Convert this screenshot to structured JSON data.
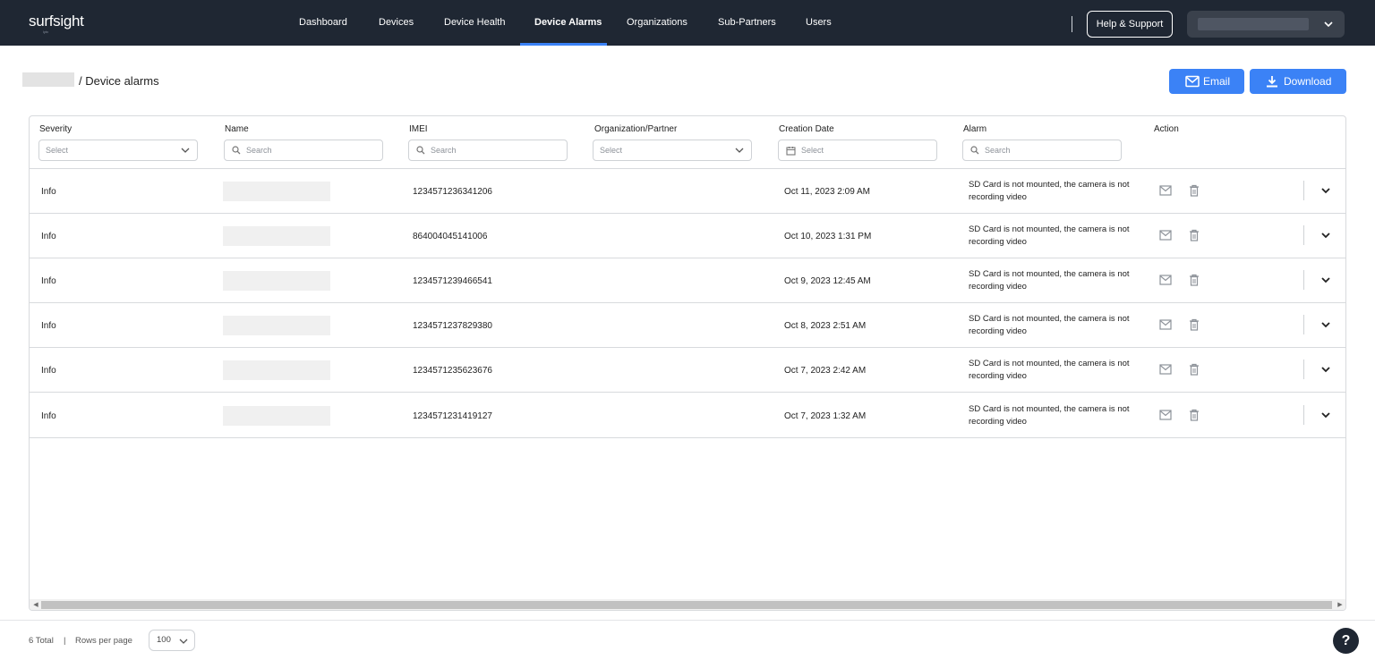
{
  "app": {
    "logo": "surfsight",
    "logo_sub": "lytx"
  },
  "nav": {
    "items": [
      "Dashboard",
      "Devices",
      "Device Health",
      "Device Alarms",
      "Organizations",
      "Sub-Partners",
      "Users"
    ],
    "active": "Device Alarms",
    "help_label": "Help & Support"
  },
  "page": {
    "title": "/ Device alarms"
  },
  "toolbar": {
    "email_label": "Email",
    "download_label": "Download"
  },
  "colors": {
    "nav_bg": "#1f2733",
    "accent": "#3b82f6"
  },
  "table": {
    "columns": [
      "Severity",
      "Name",
      "IMEI",
      "Organization/Partner",
      "Creation Date",
      "Alarm",
      "Action"
    ],
    "filters": {
      "severity": "Select",
      "name": "Search",
      "imei": "Search",
      "organization": "Select",
      "creation_date": "Select",
      "alarm": "Search"
    },
    "rows": [
      {
        "severity": "Info",
        "imei": "1234571236341206",
        "date": "Oct 11, 2023 2:09 AM",
        "alarm": "SD Card is not mounted, the camera is not recording video"
      },
      {
        "severity": "Info",
        "imei": "864004045141006",
        "date": "Oct 10, 2023 1:31 PM",
        "alarm": "SD Card is not mounted, the camera is not recording video"
      },
      {
        "severity": "Info",
        "imei": "1234571239466541",
        "date": "Oct 9, 2023 12:45 AM",
        "alarm": "SD Card is not mounted, the camera is not recording video"
      },
      {
        "severity": "Info",
        "imei": "1234571237829380",
        "date": "Oct 8, 2023 2:51 AM",
        "alarm": "SD Card is not mounted, the camera is not recording video"
      },
      {
        "severity": "Info",
        "imei": "1234571235623676",
        "date": "Oct 7, 2023 2:42 AM",
        "alarm": "SD Card is not mounted, the camera is not recording video"
      },
      {
        "severity": "Info",
        "imei": "1234571231419127",
        "date": "Oct 7, 2023 1:32 AM",
        "alarm": "SD Card is not mounted, the camera is not recording video"
      }
    ]
  },
  "footer": {
    "total": "6 Total",
    "separator": "|",
    "rows_per_page_label": "Rows per page",
    "rows_per_page": "100",
    "help_fab": "?"
  }
}
